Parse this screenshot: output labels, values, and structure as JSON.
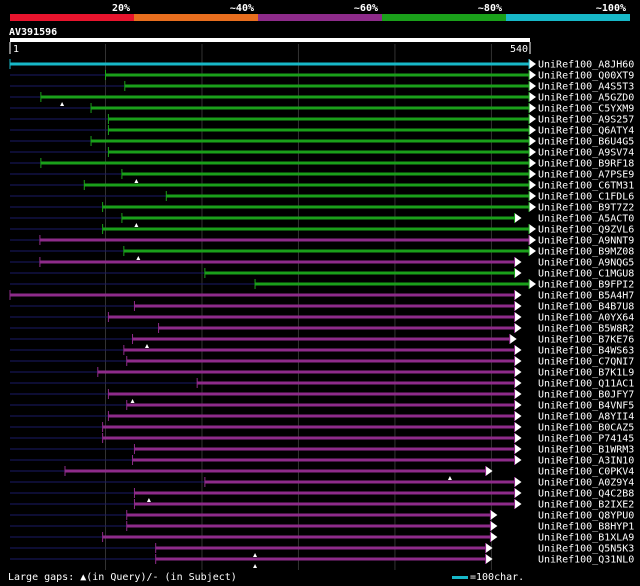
{
  "query_id": "AV391596",
  "colors": {
    "background": "#000000",
    "bin_20": "#e8142d",
    "bin_40": "#e86e1e",
    "bin_60": "#8e2b8a",
    "bin_80": "#1aa01a",
    "bin_100": "#17b8c8",
    "thin_line": "#1a1a66",
    "grid": "#333333"
  },
  "identity_bins": [
    {
      "label": "20%",
      "color_key": "bin_20"
    },
    {
      "label": "~40%",
      "color_key": "bin_40"
    },
    {
      "label": "~60%",
      "color_key": "bin_60"
    },
    {
      "label": "~80%",
      "color_key": "bin_80"
    },
    {
      "label": "~100%",
      "color_key": "bin_100"
    }
  ],
  "axis": {
    "start_label": "1",
    "end_label": "540"
  },
  "footer": {
    "gaps_legend": "Large gaps: ▲(in Query)/- (in Subject)",
    "scale_legend": "=100char."
  },
  "chart_data": {
    "type": "alignment",
    "query_length": 540,
    "gridlines": [
      100,
      200,
      300,
      400,
      500
    ],
    "hits": [
      {
        "name": "UniRef100_A8JH60",
        "bin": "bin_100",
        "start": 1,
        "end": 540
      },
      {
        "name": "UniRef100_Q00XT9",
        "bin": "bin_80",
        "start": 100,
        "end": 540
      },
      {
        "name": "UniRef100_A4S5T3",
        "bin": "bin_80",
        "start": 120,
        "end": 540
      },
      {
        "name": "UniRef100_A5GZD0",
        "bin": "bin_80",
        "start": 33,
        "end": 540,
        "query_gaps": [
          55
        ]
      },
      {
        "name": "UniRef100_C5YXM9",
        "bin": "bin_80",
        "start": 85,
        "end": 540
      },
      {
        "name": "UniRef100_A9S257",
        "bin": "bin_80",
        "start": 103,
        "end": 540
      },
      {
        "name": "UniRef100_Q6ATY4",
        "bin": "bin_80",
        "start": 103,
        "end": 540
      },
      {
        "name": "UniRef100_B6U4G5",
        "bin": "bin_80",
        "start": 85,
        "end": 540
      },
      {
        "name": "UniRef100_A9SV74",
        "bin": "bin_80",
        "start": 103,
        "end": 540
      },
      {
        "name": "UniRef100_B9RF18",
        "bin": "bin_80",
        "start": 33,
        "end": 540
      },
      {
        "name": "UniRef100_A7PSE9",
        "bin": "bin_80",
        "start": 117,
        "end": 540,
        "query_gaps": [
          132
        ]
      },
      {
        "name": "UniRef100_C6TM31",
        "bin": "bin_80",
        "start": 78,
        "end": 540
      },
      {
        "name": "UniRef100_C1FDL6",
        "bin": "bin_80",
        "start": 163,
        "end": 540
      },
      {
        "name": "UniRef100_B9T7Z2",
        "bin": "bin_80",
        "start": 97,
        "end": 540
      },
      {
        "name": "UniRef100_A5ACT0",
        "bin": "bin_80",
        "start": 117,
        "end": 525,
        "query_gaps": [
          132
        ]
      },
      {
        "name": "UniRef100_Q9ZVL6",
        "bin": "bin_80",
        "start": 97,
        "end": 540
      },
      {
        "name": "UniRef100_A9NNT9",
        "bin": "bin_60",
        "start": 32,
        "end": 540
      },
      {
        "name": "UniRef100_B9MZ08",
        "bin": "bin_80",
        "start": 119,
        "end": 540,
        "query_gaps": [
          134
        ]
      },
      {
        "name": "UniRef100_A9NQG5",
        "bin": "bin_60",
        "start": 32,
        "end": 525
      },
      {
        "name": "UniRef100_C1MGU8",
        "bin": "bin_80",
        "start": 203,
        "end": 525
      },
      {
        "name": "UniRef100_B9FPI2",
        "bin": "bin_80",
        "start": 255,
        "end": 540
      },
      {
        "name": "UniRef100_B5A4H7",
        "bin": "bin_60",
        "start": 1,
        "end": 525
      },
      {
        "name": "UniRef100_B4B7U8",
        "bin": "bin_60",
        "start": 130,
        "end": 525
      },
      {
        "name": "UniRef100_A0YX64",
        "bin": "bin_60",
        "start": 103,
        "end": 525
      },
      {
        "name": "UniRef100_B5W8R2",
        "bin": "bin_60",
        "start": 155,
        "end": 525
      },
      {
        "name": "UniRef100_B7KE76",
        "bin": "bin_60",
        "start": 128,
        "end": 520,
        "query_gaps": [
          143
        ]
      },
      {
        "name": "UniRef100_B4WS63",
        "bin": "bin_60",
        "start": 119,
        "end": 525
      },
      {
        "name": "UniRef100_C7QNI7",
        "bin": "bin_60",
        "start": 122,
        "end": 525
      },
      {
        "name": "UniRef100_B7K1L9",
        "bin": "bin_60",
        "start": 92,
        "end": 525
      },
      {
        "name": "UniRef100_Q11AC1",
        "bin": "bin_60",
        "start": 195,
        "end": 525
      },
      {
        "name": "UniRef100_B0JFY7",
        "bin": "bin_60",
        "start": 103,
        "end": 525,
        "query_gaps": [
          128
        ]
      },
      {
        "name": "UniRef100_B4VNF5",
        "bin": "bin_60",
        "start": 122,
        "end": 525
      },
      {
        "name": "UniRef100_A8YII4",
        "bin": "bin_60",
        "start": 103,
        "end": 525
      },
      {
        "name": "UniRef100_B0CAZ5",
        "bin": "bin_60",
        "start": 97,
        "end": 525
      },
      {
        "name": "UniRef100_P74145",
        "bin": "bin_60",
        "start": 97,
        "end": 525
      },
      {
        "name": "UniRef100_B1WRM3",
        "bin": "bin_60",
        "start": 130,
        "end": 525
      },
      {
        "name": "UniRef100_A3IN10",
        "bin": "bin_60",
        "start": 128,
        "end": 525
      },
      {
        "name": "UniRef100_C0PKV4",
        "bin": "bin_60",
        "start": 58,
        "end": 495,
        "query_gaps": [
          457
        ]
      },
      {
        "name": "UniRef100_A0Z9Y4",
        "bin": "bin_60",
        "start": 203,
        "end": 525
      },
      {
        "name": "UniRef100_Q4C2B8",
        "bin": "bin_60",
        "start": 130,
        "end": 525,
        "query_gaps": [
          145
        ]
      },
      {
        "name": "UniRef100_B2IXE2",
        "bin": "bin_60",
        "start": 130,
        "end": 525
      },
      {
        "name": "UniRef100_Q8YPU0",
        "bin": "bin_60",
        "start": 122,
        "end": 500
      },
      {
        "name": "UniRef100_B8HYP1",
        "bin": "bin_60",
        "start": 122,
        "end": 500
      },
      {
        "name": "UniRef100_B1XLA9",
        "bin": "bin_60",
        "start": 97,
        "end": 500
      },
      {
        "name": "UniRef100_Q5N5K3",
        "bin": "bin_60",
        "start": 152,
        "end": 495,
        "query_gaps": [
          255
        ]
      },
      {
        "name": "UniRef100_Q31NL0",
        "bin": "bin_60",
        "start": 152,
        "end": 495,
        "query_gaps": [
          255
        ]
      }
    ]
  }
}
